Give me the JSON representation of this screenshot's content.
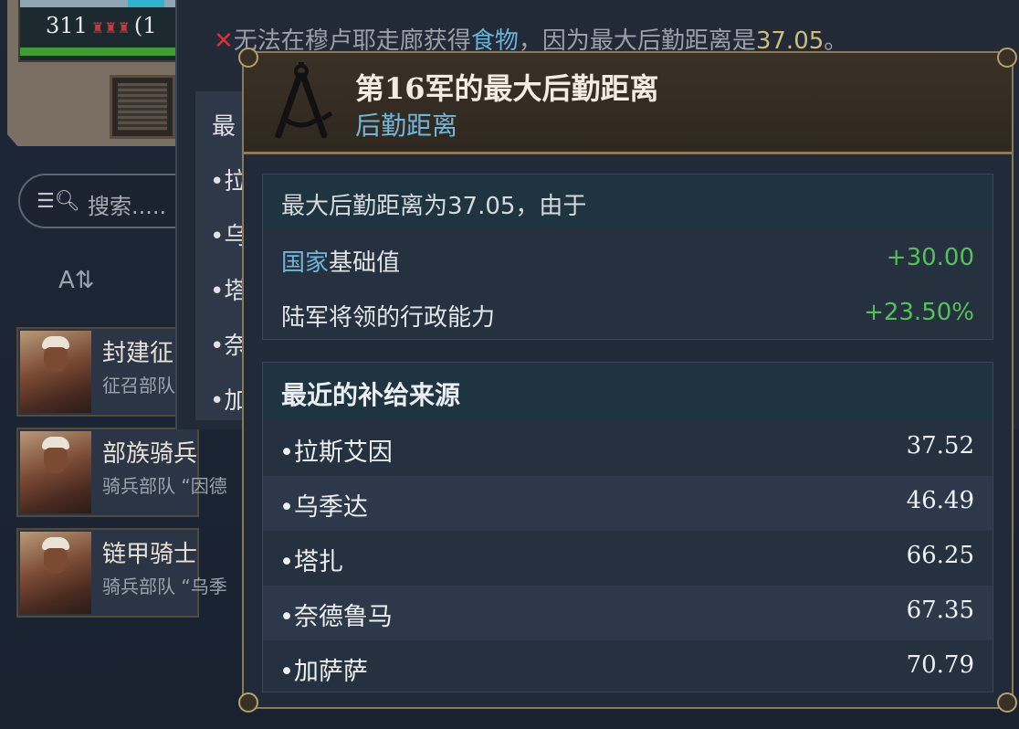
{
  "army": {
    "count": "311",
    "count_suffix": "(1"
  },
  "search": {
    "placeholder": "搜索....."
  },
  "units": [
    {
      "name": "封建征",
      "sub": "征召部队"
    },
    {
      "name": "部族骑兵",
      "sub": "骑兵部队 “因德"
    },
    {
      "name": "链甲骑士",
      "sub": "骑兵部队 “乌季"
    }
  ],
  "warning": {
    "prefix": "无法在穆卢耶走廊获得",
    "highlight": "食物",
    "middle": "，因为最大后勤距离是",
    "value": "37.05",
    "suffix": "。"
  },
  "back_panel": {
    "header": "最",
    "rows": [
      "•拉",
      "•乌",
      "•塔",
      "•奈",
      "•加"
    ]
  },
  "tooltip": {
    "title": "第16军的最大后勤距离",
    "subtitle": "后勤距离",
    "summary": "最大后勤距离为37.05，由于",
    "modifiers": [
      {
        "label_hl": "国家",
        "label": "基础值",
        "value": "+30.00"
      },
      {
        "label_hl": "",
        "label": "陆军将领的行政能力",
        "value": "+23.50%"
      }
    ],
    "sources_title": "最近的补给来源",
    "sources": [
      {
        "name": "•拉斯艾因",
        "value": "37.52"
      },
      {
        "name": "•乌季达",
        "value": "46.49"
      },
      {
        "name": "•塔扎",
        "value": "66.25"
      },
      {
        "name": "•奈德鲁马",
        "value": "67.35"
      },
      {
        "name": "•加萨萨",
        "value": "70.79"
      }
    ]
  },
  "colors": {
    "positive": "#54c05a",
    "highlight_blue": "#6fb6da",
    "gold_border": "#8b7a56",
    "error_red": "#d7322f"
  },
  "icons": [
    "search-icon",
    "sort-az-icon",
    "compass-icon",
    "close-x-icon",
    "soldiers-icon"
  ]
}
